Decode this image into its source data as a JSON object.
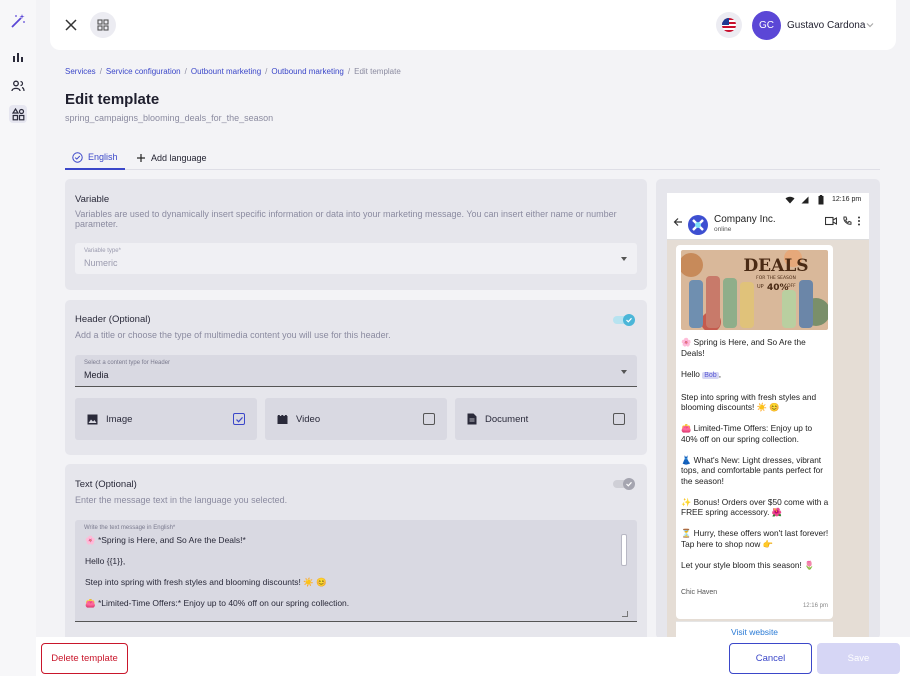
{
  "topbar": {
    "user_initials": "GC",
    "user_name": "Gustavo Cardona",
    "language_flag": "us-flag-icon"
  },
  "sidebar": {
    "items": [
      {
        "icon": "magic-wand-icon"
      },
      {
        "icon": "bar-chart-icon"
      },
      {
        "icon": "users-icon"
      },
      {
        "icon": "shapes-icon",
        "active": true
      }
    ]
  },
  "breadcrumb": {
    "items": [
      "Services",
      "Service configuration",
      "Outbount marketing",
      "Outbound marketing"
    ],
    "current": "Edit template"
  },
  "page": {
    "title": "Edit template",
    "subtitle": "spring_campaigns_blooming_deals_for_the_season"
  },
  "tabs": {
    "english": "English",
    "add_language": "Add language"
  },
  "variable": {
    "title": "Variable",
    "description": "Variables are used to dynamically insert specific information or data into your marketing message. You can insert either name or number parameter.",
    "type_label": "Variable type*",
    "type_value": "Numeric"
  },
  "header": {
    "title": "Header (Optional)",
    "description": "Add a title or choose the type of multimedia content you will use for this header.",
    "enabled": true,
    "content_type_label": "Select a content type for Header",
    "content_type_value": "Media",
    "options": [
      {
        "label": "Image",
        "checked": true
      },
      {
        "label": "Video",
        "checked": false
      },
      {
        "label": "Document",
        "checked": false
      }
    ]
  },
  "text": {
    "title": "Text (Optional)",
    "description": "Enter the message text in the language you selected.",
    "enabled": false,
    "field_label": "Write the text message in English*",
    "lines": [
      "🌸 *Spring is Here, and So Are the Deals!*",
      "",
      "Hello {{1}},",
      "",
      "Step into spring with fresh styles and blooming discounts! ☀️ 😊",
      "",
      "👛 *Limited-Time Offers:* Enjoy up to 40% off on our spring collection."
    ]
  },
  "preview": {
    "time": "12:16 pm",
    "company": "Company Inc.",
    "status": "online",
    "promo_title": "DEALS",
    "promo_sub": "FOR THE SEASON",
    "promo_pct": "40%",
    "promo_upto": "UP",
    "promo_off": "OFF",
    "msg_heading": "🌸 Spring is Here, and So Are the Deals!",
    "msg_hello": "Hello",
    "msg_var": "Bob",
    "msg_p1": "Step into spring with fresh styles and blooming discounts! ☀️ 😊",
    "msg_p2": "👛 Limited-Time Offers: Enjoy up to 40% off on our spring collection.",
    "msg_p3": "👗 What's New: Light dresses, vibrant tops, and comfortable pants perfect for the season!",
    "msg_p4": "✨ Bonus! Orders over $50 come with a FREE spring accessory. 🌺",
    "msg_p5a": "⏳ Hurry, these offers won't last forever!",
    "msg_p5b": "Tap here to shop now 👉",
    "msg_p6": "Let your style bloom this season! 🌷",
    "signature": "Chic Haven",
    "msg_time": "12:16 pm",
    "link": "Visit website"
  },
  "footer": {
    "delete": "Delete template",
    "cancel": "Cancel",
    "save": "Save"
  },
  "colors": {
    "accent": "#3b47c9",
    "danger": "#c9162b",
    "avatar": "#5b47d6",
    "toggle_on": "#4bb6d8"
  }
}
